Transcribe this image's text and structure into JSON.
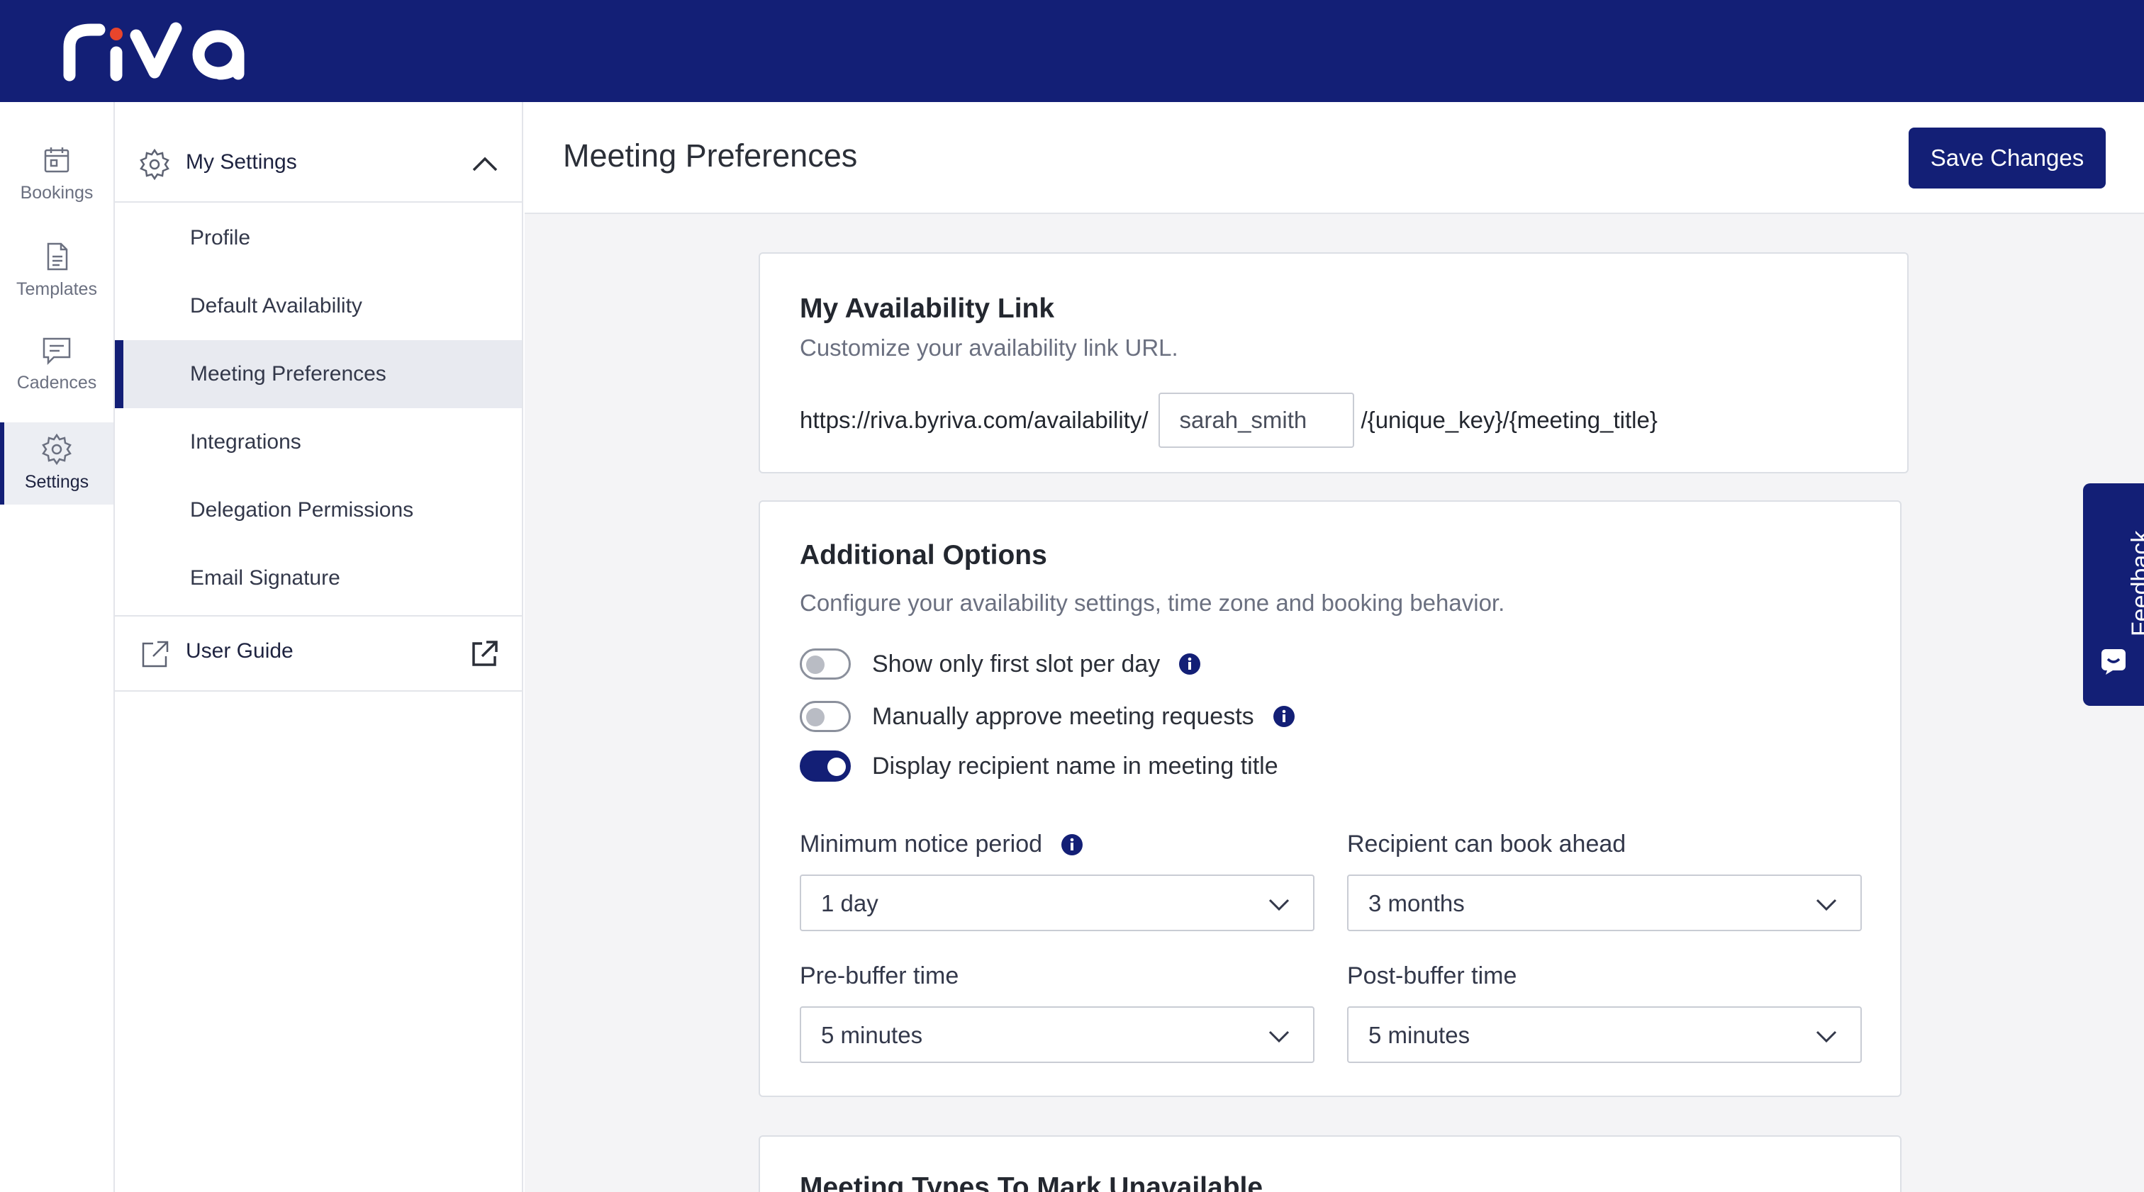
{
  "brand": {
    "logo_text": "riva",
    "primary_color": "#131f76",
    "accent_color": "#e8452c"
  },
  "rail": {
    "items": [
      {
        "label": "Bookings",
        "icon": "calendar-icon"
      },
      {
        "label": "Templates",
        "icon": "document-icon"
      },
      {
        "label": "Cadences",
        "icon": "message-icon"
      },
      {
        "label": "Settings",
        "icon": "gear-icon",
        "active": true
      }
    ]
  },
  "subnav": {
    "section": "My Settings",
    "items": [
      {
        "label": "Profile"
      },
      {
        "label": "Default Availability"
      },
      {
        "label": "Meeting Preferences",
        "active": true
      },
      {
        "label": "Integrations"
      },
      {
        "label": "Delegation Permissions"
      },
      {
        "label": "Email Signature"
      }
    ],
    "guide": "User Guide"
  },
  "header": {
    "title": "Meeting Preferences",
    "save_label": "Save Changes"
  },
  "availability_link": {
    "title": "My Availability Link",
    "subtitle": "Customize your availability link URL.",
    "url_prefix": "https://riva.byriva.com/availability/",
    "slug_value": "sarah_smith",
    "url_suffix": "/{unique_key}/{meeting_title}"
  },
  "additional_options": {
    "title": "Additional Options",
    "subtitle": "Configure your availability settings, time zone and booking behavior.",
    "toggles": [
      {
        "label": "Show only first slot per day",
        "on": false,
        "info": true
      },
      {
        "label": "Manually approve meeting requests",
        "on": false,
        "info": true
      },
      {
        "label": "Display recipient name in meeting title",
        "on": true,
        "info": false
      }
    ],
    "fields": {
      "min_notice": {
        "label": "Minimum notice period",
        "value": "1 day"
      },
      "book_ahead": {
        "label": "Recipient can book ahead",
        "value": "3 months"
      },
      "pre_buffer": {
        "label": "Pre-buffer time",
        "value": "5 minutes"
      },
      "post_buffer": {
        "label": "Post-buffer time",
        "value": "5 minutes"
      }
    }
  },
  "meeting_types": {
    "title": "Meeting Types To Mark Unavailable"
  },
  "feedback": {
    "label": "Feedback"
  }
}
